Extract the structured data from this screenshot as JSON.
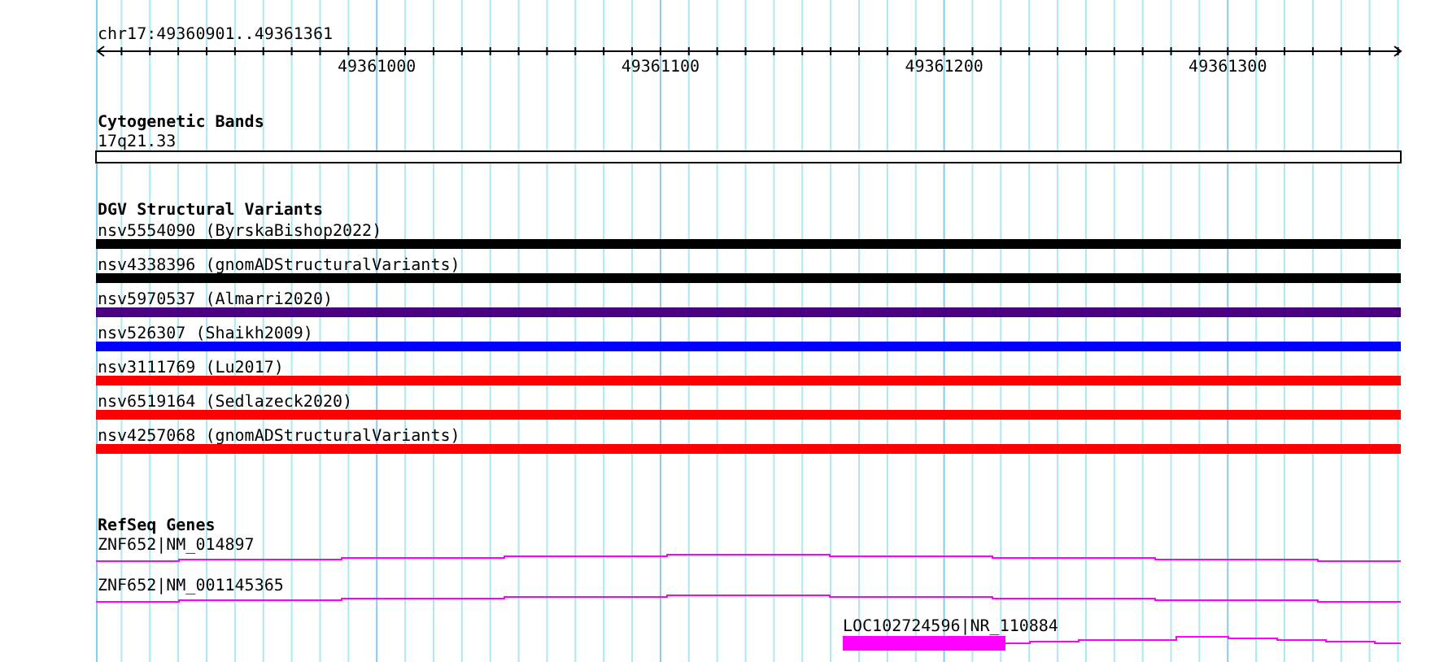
{
  "ruler": {
    "position": "chr17:49360901..49361361",
    "ticks": [
      "49361000",
      "49361100",
      "49361200",
      "49361300"
    ]
  },
  "cytogenetic_bands": {
    "title": "Cytogenetic Bands",
    "band": "17q21.33"
  },
  "dgv": {
    "title": "DGV Structural Variants",
    "variants": [
      {
        "label": "nsv5554090 (ByrskaBishop2022)",
        "color": "#000000"
      },
      {
        "label": "nsv4338396 (gnomADStructuralVariants)",
        "color": "#000000"
      },
      {
        "label": "nsv5970537 (Almarri2020)",
        "color": "#4b0082"
      },
      {
        "label": "nsv526307 (Shaikh2009)",
        "color": "#0000ff"
      },
      {
        "label": "nsv3111769 (Lu2017)",
        "color": "#ff0000"
      },
      {
        "label": "nsv6519164 (Sedlazeck2020)",
        "color": "#ff0000"
      },
      {
        "label": "nsv4257068 (gnomADStructuralVariants)",
        "color": "#ff0000"
      }
    ]
  },
  "refseq": {
    "title": "RefSeq Genes",
    "genes": [
      {
        "label": "ZNF652|NM_014897",
        "kind": "intron"
      },
      {
        "label": "ZNF652|NM_001145365",
        "kind": "intron"
      },
      {
        "label": "LOC102724596|NR_110884",
        "kind": "exon"
      }
    ]
  }
}
